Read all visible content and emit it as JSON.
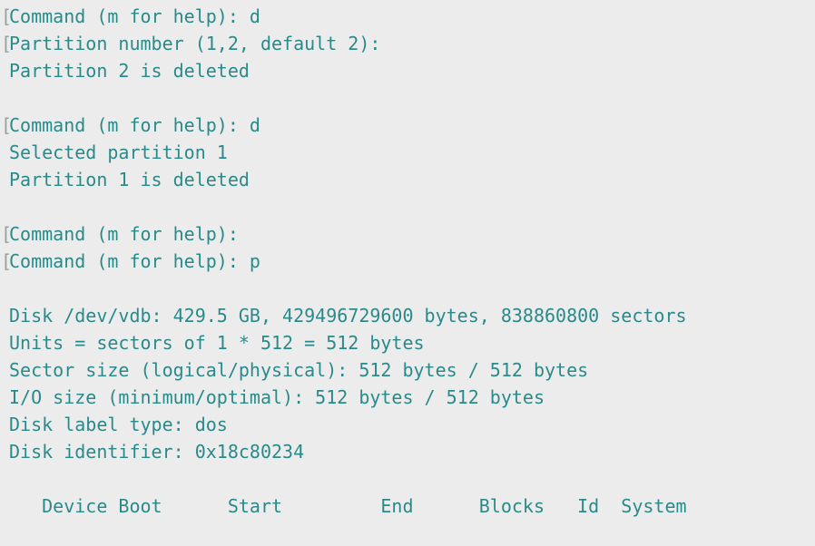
{
  "terminal": {
    "lines": [
      {
        "text": "Command (m for help): d",
        "prompt": true
      },
      {
        "text": "Partition number (1,2, default 2):",
        "prompt": true
      },
      {
        "text": "Partition 2 is deleted",
        "prompt": false
      },
      {
        "text": "",
        "prompt": false
      },
      {
        "text": "Command (m for help): d",
        "prompt": true
      },
      {
        "text": "Selected partition 1",
        "prompt": false
      },
      {
        "text": "Partition 1 is deleted",
        "prompt": false
      },
      {
        "text": "",
        "prompt": false
      },
      {
        "text": "Command (m for help):",
        "prompt": true
      },
      {
        "text": "Command (m for help): p",
        "prompt": true
      },
      {
        "text": "",
        "prompt": false
      },
      {
        "text": "Disk /dev/vdb: 429.5 GB, 429496729600 bytes, 838860800 sectors",
        "prompt": false
      },
      {
        "text": "Units = sectors of 1 * 512 = 512 bytes",
        "prompt": false
      },
      {
        "text": "Sector size (logical/physical): 512 bytes / 512 bytes",
        "prompt": false
      },
      {
        "text": "I/O size (minimum/optimal): 512 bytes / 512 bytes",
        "prompt": false
      },
      {
        "text": "Disk label type: dos",
        "prompt": false
      },
      {
        "text": "Disk identifier: 0x18c80234",
        "prompt": false
      },
      {
        "text": "",
        "prompt": false
      },
      {
        "text": "   Device Boot      Start         End      Blocks   Id  System",
        "prompt": false
      }
    ],
    "bracket_glyph": "[",
    "colors": {
      "background": "#ececec",
      "text": "#2a8a8a",
      "bracket": "#9aa0a0"
    }
  }
}
